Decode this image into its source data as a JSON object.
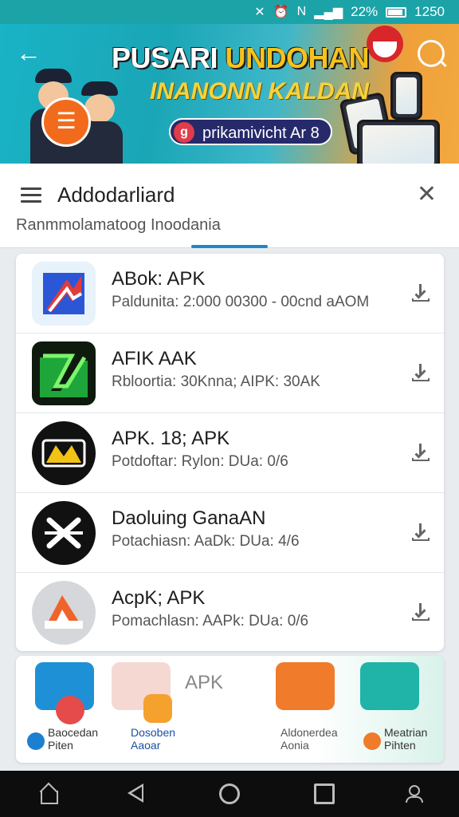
{
  "status_bar": {
    "battery": "22%",
    "time": "1250"
  },
  "banner": {
    "title_left": "PUSARI",
    "title_right": "UNDOHAN",
    "subtitle": "INANONN KALDAN",
    "pill_text": "prikamivicht Ar 8",
    "pill_icon_glyph": "g"
  },
  "header": {
    "title": "Addodarliard",
    "subtitle": "Ranmmolamatoog Inoodania"
  },
  "apps": [
    {
      "name": "ABok: APK",
      "meta": "Paldunita: 2:000 00300 - 00cnd aAOM",
      "icon": "blue-red-arrow-icon"
    },
    {
      "name": "AFIK AAK",
      "meta": "Rbloortia: 30Knna; AIPK: 30AK",
      "icon": "green-lightning-icon"
    },
    {
      "name": "APK. 18; APK",
      "meta": "Potdoftar: Rylon: DUa: 0/6",
      "icon": "black-yellow-badge-icon"
    },
    {
      "name": "Daoluing GanaAN",
      "meta": "Potachiasn: AaDk: DUa: 4/6",
      "icon": "black-x-icon"
    },
    {
      "name": "AcpK; APK",
      "meta": "Pomachlasn: AAPk: DUa: 0/6",
      "icon": "red-triangle-logo-icon"
    }
  ],
  "promo": {
    "center_label": "APK",
    "nav": [
      {
        "line1": "Baocedan",
        "line2": "Piten"
      },
      {
        "line1": "Dosoben",
        "line2": "Aaoar"
      },
      {
        "line1": "Aldonerdea",
        "line2": "Aonia"
      },
      {
        "line1": "Meatrian",
        "line2": "Pihten"
      }
    ]
  },
  "colors": {
    "accent": "#1e88c7",
    "banner_teal": "#19b3c6",
    "banner_orange": "#f0a03a"
  }
}
